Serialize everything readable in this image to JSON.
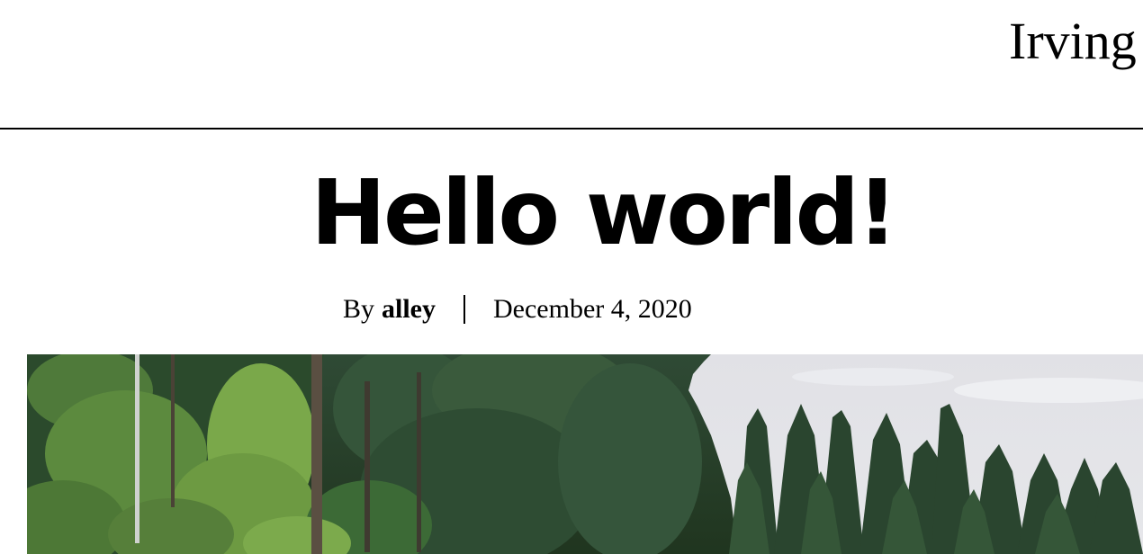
{
  "site": {
    "title": "Irving"
  },
  "post": {
    "title": "Hello world!",
    "byline_prefix": "By",
    "author": "alley",
    "date": "December 4, 2020"
  },
  "hero": {
    "image_name": "forest-tree-line-photo",
    "colors": {
      "sky": "#e3e3e8",
      "dark_green": "#2a4230",
      "mid_green": "#3e5f3a",
      "bright_green": "#7aa84a",
      "trunk": "#5a4f42"
    }
  }
}
